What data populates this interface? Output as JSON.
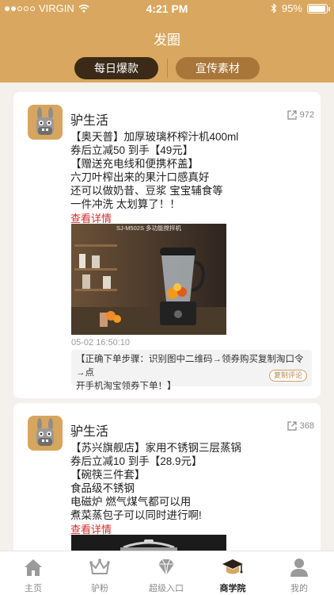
{
  "status_bar": {
    "carrier": "VIRGIN",
    "time": "4:21 PM",
    "battery_percent": "95%",
    "battery_level": 0.95
  },
  "nav": {
    "title": "发圈",
    "tabs": [
      {
        "label": "每日爆款",
        "active": true
      },
      {
        "label": "宣传素材",
        "active": false
      }
    ]
  },
  "posts": [
    {
      "author": "驴生活",
      "share_count": "972",
      "lines": [
        "【奥天普】加厚玻璃杯榨汁机400ml",
        "券后立减50 到手【49元】",
        "【赠送充电线和便携杯盖】",
        "六刀叶榨出来的果汁口感真好",
        "还可以做奶昔、豆浆 宝宝辅食等",
        "一件冲洗 太划算了！！"
      ],
      "detail_link": "查看详情",
      "image_caption": "SJ-M502S 多功能搅拌机",
      "timestamp": "05-02  16:50:10",
      "tip_lines": [
        "【正确下单步骤：识别图中二维码→领券购买复制淘口令→点",
        "开手机淘宝领券下单！】"
      ],
      "copy_button": "复制评论"
    },
    {
      "author": "驴生活",
      "share_count": "368",
      "lines": [
        "【苏兴旗舰店】家用不锈钢三层蒸锅",
        "券后立减10 到手【28.9元】",
        "【碗筷三件套】",
        "食品级不锈钢",
        "电磁炉 燃气煤气都可以用",
        "煮菜蒸包子可以同时进行啊!"
      ],
      "detail_link": "查看详情"
    }
  ],
  "tabbar": [
    {
      "label": "主页",
      "icon": "home-icon",
      "active": false
    },
    {
      "label": "驴粉",
      "icon": "crown-icon",
      "active": false
    },
    {
      "label": "超级入口",
      "icon": "diamond-icon",
      "active": false
    },
    {
      "label": "商学院",
      "icon": "graduation-cap-icon",
      "active": true
    },
    {
      "label": "我的",
      "icon": "person-icon",
      "active": false
    }
  ],
  "colors": {
    "brand": "#d9a75f",
    "dark_tab": "#3a2a17",
    "link_red": "#d62a2a"
  }
}
